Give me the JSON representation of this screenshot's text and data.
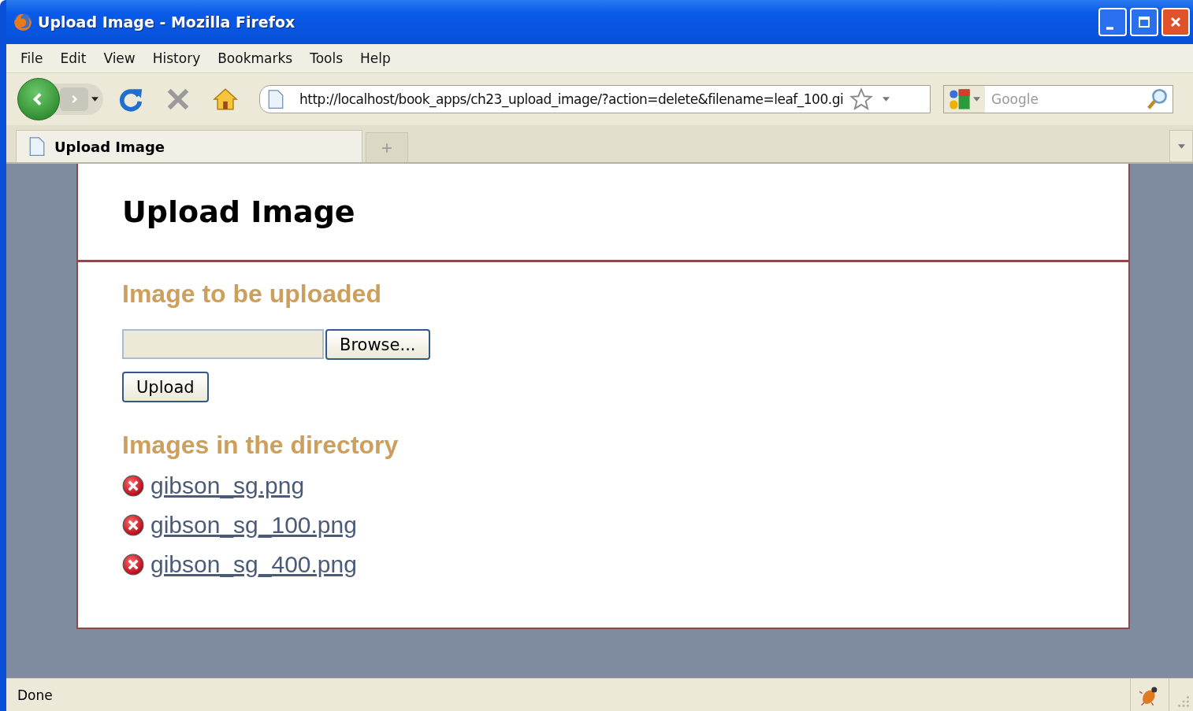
{
  "window": {
    "title": "Upload Image - Mozilla Firefox"
  },
  "menu": [
    "File",
    "Edit",
    "View",
    "History",
    "Bookmarks",
    "Tools",
    "Help"
  ],
  "address_bar": {
    "value": "http://localhost/book_apps/ch23_upload_image/?action=delete&filename=leaf_100.gi"
  },
  "search": {
    "placeholder": "Google"
  },
  "tabs": [
    {
      "label": "Upload Image",
      "selected": true
    }
  ],
  "page": {
    "heading": "Upload Image",
    "upload_heading": "Image to be uploaded",
    "browse_button": "Browse...",
    "upload_button": "Upload",
    "list_heading": "Images in the directory",
    "files": [
      {
        "name": "gibson_sg.png"
      },
      {
        "name": "gibson_sg_100.png"
      },
      {
        "name": "gibson_sg_400.png"
      }
    ]
  },
  "status_bar": {
    "text": "Done"
  }
}
